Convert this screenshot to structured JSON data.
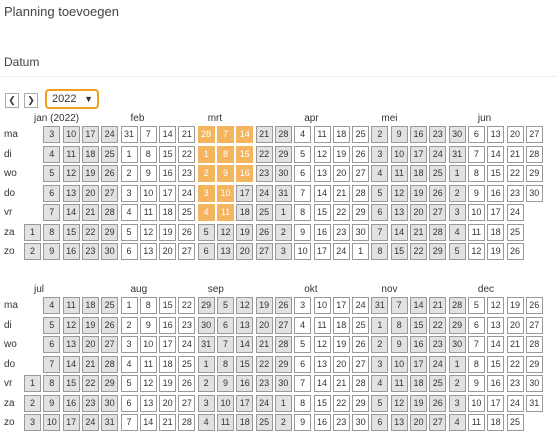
{
  "header": {
    "title": "Planning toevoegen",
    "section_label": "Datum"
  },
  "controls": {
    "prev_icon": "chevron-left-icon",
    "next_icon": "chevron-right-icon",
    "year": "2022",
    "dropdown_icon": "chevron-down-icon"
  },
  "colors": {
    "selected": "#f5b55e",
    "month_shade": "#e2e2e2",
    "focus_border": "#f0a020"
  },
  "day_labels": [
    "ma",
    "di",
    "wo",
    "do",
    "vr",
    "za",
    "zo"
  ],
  "halves": [
    {
      "months": [
        "jan (2022)",
        "feb",
        "mrt",
        "apr",
        "mei",
        "jun"
      ],
      "weeks": [
        {
          "days": [
            "",
            "",
            "",
            "",
            "",
            "1",
            "2"
          ],
          "shaded": true
        },
        {
          "days": [
            "3",
            "4",
            "5",
            "6",
            "7",
            "8",
            "9"
          ],
          "shaded": true
        },
        {
          "days": [
            "10",
            "11",
            "12",
            "13",
            "14",
            "15",
            "16"
          ],
          "shaded": true
        },
        {
          "days": [
            "17",
            "18",
            "19",
            "20",
            "21",
            "22",
            "23"
          ],
          "shaded": true
        },
        {
          "days": [
            "24",
            "25",
            "26",
            "27",
            "28",
            "29",
            "30"
          ],
          "shaded": true
        },
        {
          "days": [
            "31",
            "1",
            "2",
            "3",
            "4",
            "5",
            "6"
          ],
          "shaded": false
        },
        {
          "days": [
            "7",
            "8",
            "9",
            "10",
            "11",
            "12",
            "13"
          ],
          "shaded": false
        },
        {
          "days": [
            "14",
            "15",
            "16",
            "17",
            "18",
            "19",
            "20"
          ],
          "shaded": false
        },
        {
          "days": [
            "21",
            "22",
            "23",
            "24",
            "25",
            "26",
            "27"
          ],
          "shaded": false
        },
        {
          "days": [
            "28",
            "1",
            "2",
            "3",
            "4",
            "5",
            "6"
          ],
          "shaded": true
        },
        {
          "days": [
            "7",
            "8",
            "9",
            "10",
            "11",
            "12",
            "13"
          ],
          "shaded": true
        },
        {
          "days": [
            "14",
            "15",
            "16",
            "17",
            "18",
            "19",
            "20"
          ],
          "shaded": true
        },
        {
          "days": [
            "21",
            "22",
            "23",
            "24",
            "25",
            "26",
            "27"
          ],
          "shaded": true
        },
        {
          "days": [
            "28",
            "29",
            "30",
            "31",
            "1",
            "2",
            "3"
          ],
          "shaded": true
        },
        {
          "days": [
            "4",
            "5",
            "6",
            "7",
            "8",
            "9",
            "10"
          ],
          "shaded": false
        },
        {
          "days": [
            "11",
            "12",
            "13",
            "14",
            "15",
            "16",
            "17"
          ],
          "shaded": false
        },
        {
          "days": [
            "18",
            "19",
            "20",
            "21",
            "22",
            "23",
            "24"
          ],
          "shaded": false
        },
        {
          "days": [
            "25",
            "26",
            "27",
            "28",
            "29",
            "30",
            "1"
          ],
          "shaded": false
        },
        {
          "days": [
            "2",
            "3",
            "4",
            "5",
            "6",
            "7",
            "8"
          ],
          "shaded": true
        },
        {
          "days": [
            "9",
            "10",
            "11",
            "12",
            "13",
            "14",
            "15"
          ],
          "shaded": true
        },
        {
          "days": [
            "16",
            "17",
            "18",
            "19",
            "20",
            "21",
            "22"
          ],
          "shaded": true
        },
        {
          "days": [
            "23",
            "24",
            "25",
            "26",
            "27",
            "28",
            "29"
          ],
          "shaded": true
        },
        {
          "days": [
            "30",
            "31",
            "1",
            "2",
            "3",
            "4",
            "5"
          ],
          "shaded": true
        },
        {
          "days": [
            "6",
            "7",
            "8",
            "9",
            "10",
            "11",
            "12"
          ],
          "shaded": false
        },
        {
          "days": [
            "13",
            "14",
            "15",
            "16",
            "17",
            "18",
            "19"
          ],
          "shaded": false
        },
        {
          "days": [
            "20",
            "21",
            "22",
            "23",
            "24",
            "25",
            "26"
          ],
          "shaded": false
        },
        {
          "days": [
            "27",
            "28",
            "29",
            "30",
            "",
            "",
            ""
          ],
          "shaded": false
        }
      ],
      "selected": [
        [
          9,
          0
        ],
        [
          10,
          0
        ],
        [
          11,
          0
        ],
        [
          9,
          1
        ],
        [
          10,
          1
        ],
        [
          11,
          1
        ],
        [
          9,
          2
        ],
        [
          10,
          2
        ],
        [
          11,
          2
        ],
        [
          9,
          3
        ],
        [
          10,
          3
        ],
        [
          9,
          4
        ],
        [
          10,
          4
        ]
      ]
    },
    {
      "months": [
        "jul",
        "aug",
        "sep",
        "okt",
        "nov",
        "dec"
      ],
      "weeks": [
        {
          "days": [
            "",
            "",
            "",
            "",
            "1",
            "2",
            "3"
          ],
          "shaded": true
        },
        {
          "days": [
            "4",
            "5",
            "6",
            "7",
            "8",
            "9",
            "10"
          ],
          "shaded": true
        },
        {
          "days": [
            "11",
            "12",
            "13",
            "14",
            "15",
            "16",
            "17"
          ],
          "shaded": true
        },
        {
          "days": [
            "18",
            "19",
            "20",
            "21",
            "22",
            "23",
            "24"
          ],
          "shaded": true
        },
        {
          "days": [
            "25",
            "26",
            "27",
            "28",
            "29",
            "30",
            "31"
          ],
          "shaded": true
        },
        {
          "days": [
            "1",
            "2",
            "3",
            "4",
            "5",
            "6",
            "7"
          ],
          "shaded": false
        },
        {
          "days": [
            "8",
            "9",
            "10",
            "11",
            "12",
            "13",
            "14"
          ],
          "shaded": false
        },
        {
          "days": [
            "15",
            "16",
            "17",
            "18",
            "19",
            "20",
            "21"
          ],
          "shaded": false
        },
        {
          "days": [
            "22",
            "23",
            "24",
            "25",
            "26",
            "27",
            "28"
          ],
          "shaded": false
        },
        {
          "days": [
            "29",
            "30",
            "31",
            "1",
            "2",
            "3",
            "4"
          ],
          "shaded": true
        },
        {
          "days": [
            "5",
            "6",
            "7",
            "8",
            "9",
            "10",
            "11"
          ],
          "shaded": true
        },
        {
          "days": [
            "12",
            "13",
            "14",
            "15",
            "16",
            "17",
            "18"
          ],
          "shaded": true
        },
        {
          "days": [
            "19",
            "20",
            "21",
            "22",
            "23",
            "24",
            "25"
          ],
          "shaded": true
        },
        {
          "days": [
            "26",
            "27",
            "28",
            "29",
            "30",
            "1",
            "2"
          ],
          "shaded": true
        },
        {
          "days": [
            "3",
            "4",
            "5",
            "6",
            "7",
            "8",
            "9"
          ],
          "shaded": false
        },
        {
          "days": [
            "10",
            "11",
            "12",
            "13",
            "14",
            "15",
            "16"
          ],
          "shaded": false
        },
        {
          "days": [
            "17",
            "18",
            "19",
            "20",
            "21",
            "22",
            "23"
          ],
          "shaded": false
        },
        {
          "days": [
            "24",
            "25",
            "26",
            "27",
            "28",
            "29",
            "30"
          ],
          "shaded": false
        },
        {
          "days": [
            "31",
            "1",
            "2",
            "3",
            "4",
            "5",
            "6"
          ],
          "shaded": true
        },
        {
          "days": [
            "7",
            "8",
            "9",
            "10",
            "11",
            "12",
            "13"
          ],
          "shaded": true
        },
        {
          "days": [
            "14",
            "15",
            "16",
            "17",
            "18",
            "19",
            "20"
          ],
          "shaded": true
        },
        {
          "days": [
            "21",
            "22",
            "23",
            "24",
            "25",
            "26",
            "27"
          ],
          "shaded": true
        },
        {
          "days": [
            "28",
            "29",
            "30",
            "1",
            "2",
            "3",
            "4"
          ],
          "shaded": true
        },
        {
          "days": [
            "5",
            "6",
            "7",
            "8",
            "9",
            "10",
            "11"
          ],
          "shaded": false
        },
        {
          "days": [
            "12",
            "13",
            "14",
            "15",
            "16",
            "17",
            "18"
          ],
          "shaded": false
        },
        {
          "days": [
            "19",
            "20",
            "21",
            "22",
            "23",
            "24",
            "25"
          ],
          "shaded": false
        },
        {
          "days": [
            "26",
            "27",
            "28",
            "29",
            "30",
            "31",
            ""
          ],
          "shaded": false
        }
      ],
      "selected": []
    }
  ]
}
